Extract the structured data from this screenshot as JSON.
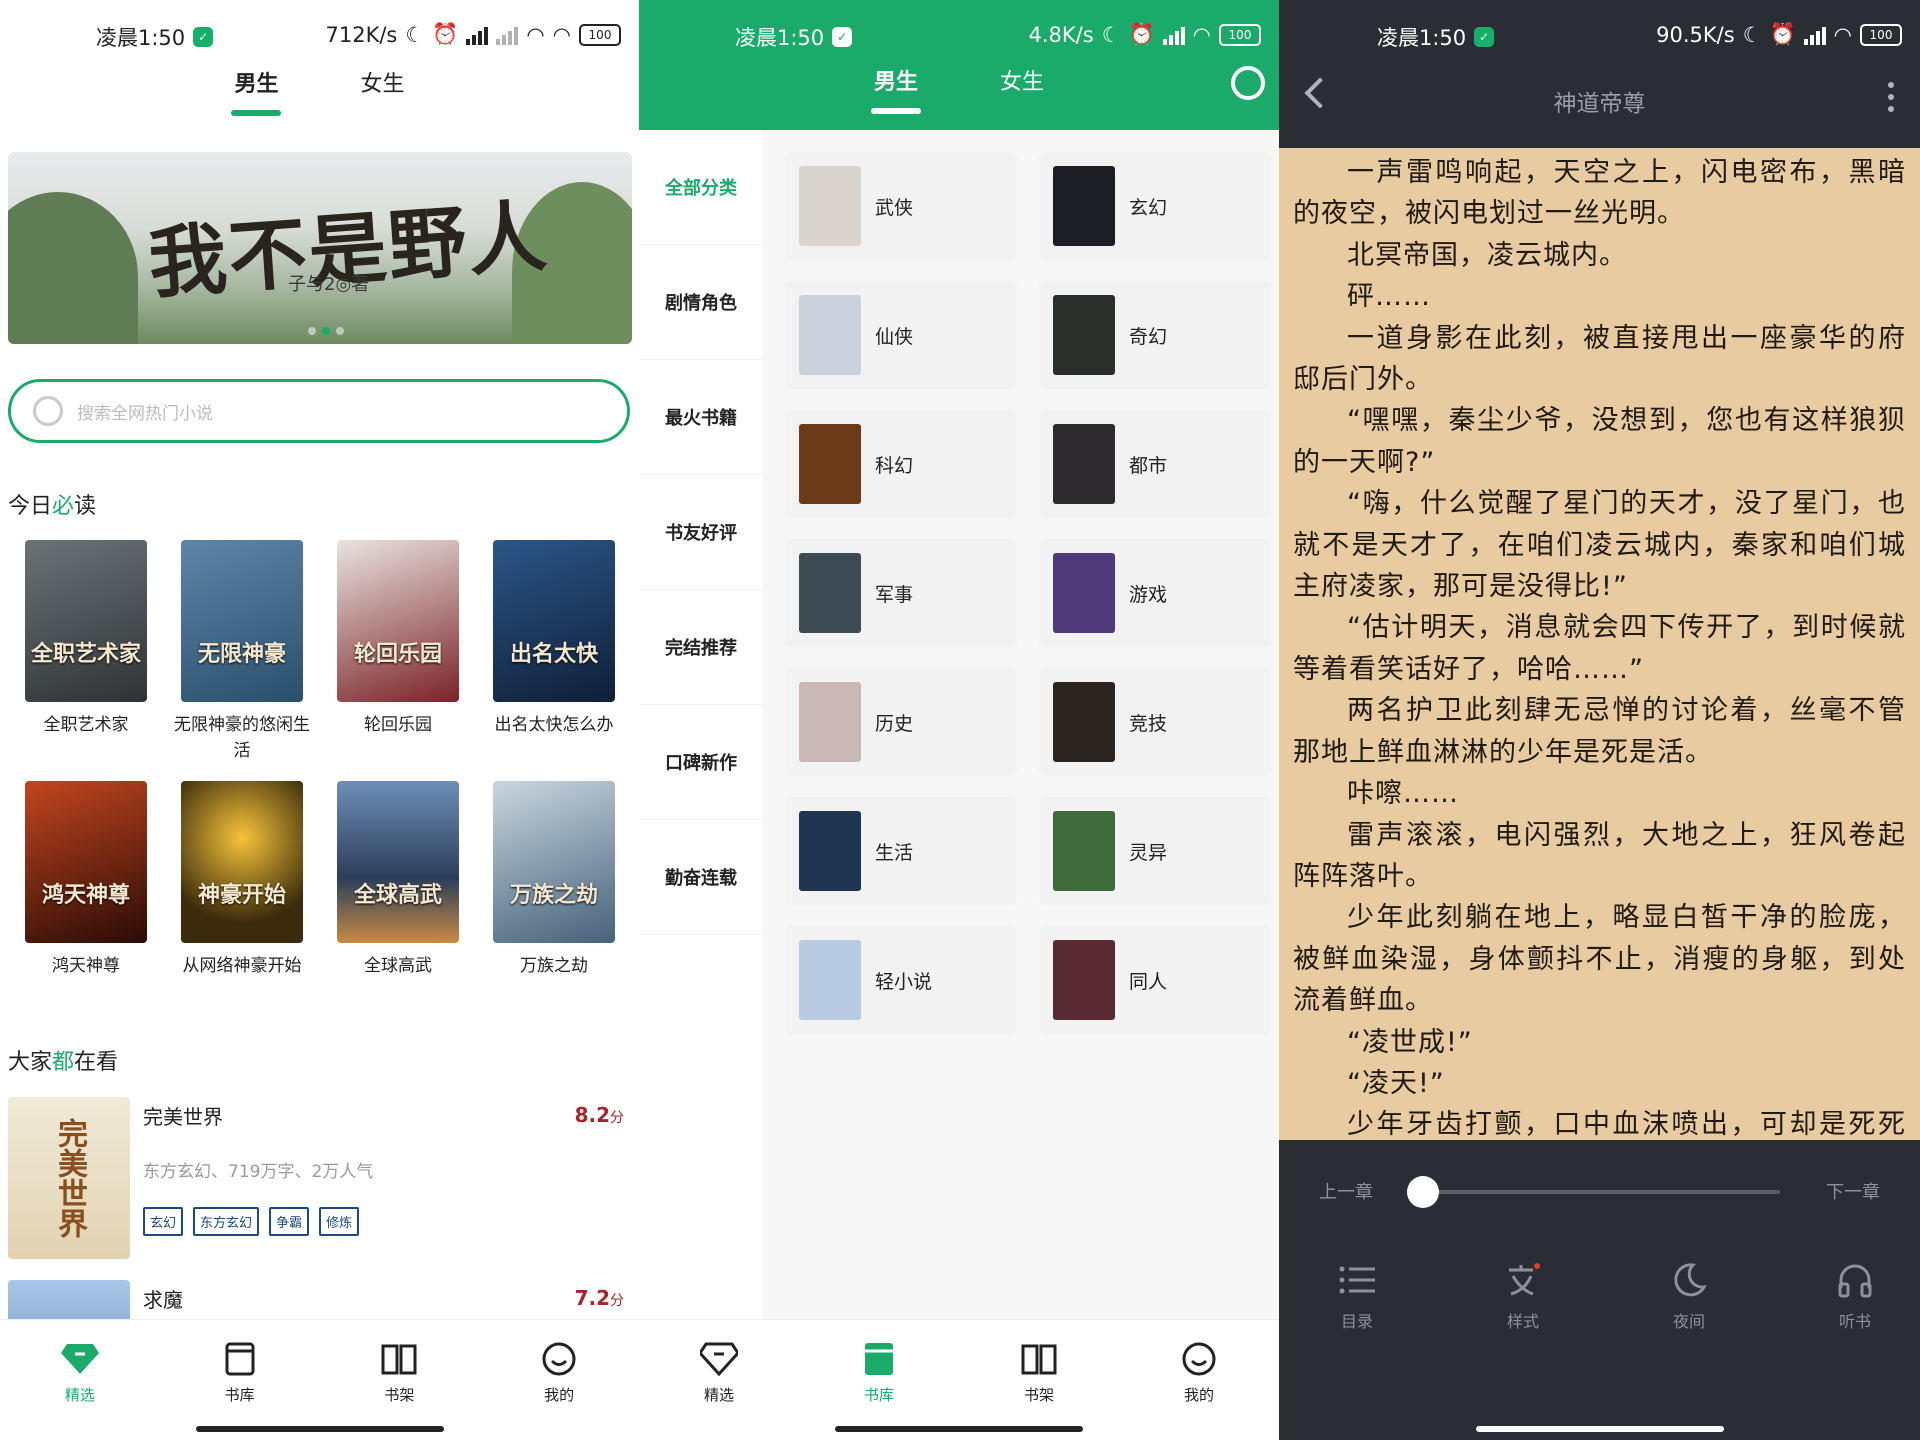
{
  "status": {
    "p1": {
      "time": "凌晨1:50",
      "speed": "712K/s",
      "battery": "100"
    },
    "p2": {
      "time": "凌晨1:50",
      "speed": "4.8K/s",
      "battery": "100"
    },
    "p3": {
      "time": "凌晨1:50",
      "speed": "90.5K/s",
      "battery": "100"
    }
  },
  "tabs": {
    "male": "男生",
    "female": "女生"
  },
  "banner": {
    "title": "我不是野人",
    "subtitle": "子与2◎著"
  },
  "search": {
    "placeholder": "搜索全网热门小说"
  },
  "today": {
    "prefix": "今日",
    "highlight": "必",
    "suffix": "读"
  },
  "books": [
    {
      "name": "全职艺术家",
      "cover_text": "全职艺术家",
      "color": "#2f3336"
    },
    {
      "name": "无限神豪的悠闲生活",
      "cover_text": "无限神豪",
      "color": "#2a4f6b"
    },
    {
      "name": "轮回乐园",
      "cover_text": "轮回乐园",
      "color": "#7b2229"
    },
    {
      "name": "出名太快怎么办",
      "cover_text": "出名太快",
      "color": "#1f3e68"
    },
    {
      "name": "鸿天神尊",
      "cover_text": "鸿天神尊",
      "color": "#5a1d12"
    },
    {
      "name": "从网络神豪开始",
      "cover_text": "神豪开始",
      "color": "#3b2b0c"
    },
    {
      "name": "全球高武",
      "cover_text": "全球高武",
      "color": "#2b3e59"
    },
    {
      "name": "万族之劫",
      "cover_text": "万族之劫",
      "color": "#46627a"
    }
  ],
  "everyone": {
    "prefix": "大家",
    "highlight": "都",
    "suffix": "在看"
  },
  "popular": [
    {
      "title": "完美世界",
      "score": "8.2",
      "unit": "分",
      "meta": "东方玄幻、719万字、2万人气",
      "tags": [
        "玄幻",
        "东方玄幻",
        "争霸",
        "修炼"
      ],
      "cover_text": "完美世界"
    },
    {
      "title": "求魔",
      "score": "7.2",
      "unit": "分"
    }
  ],
  "nav": [
    {
      "label": "精选",
      "icon": "diamond-icon"
    },
    {
      "label": "书库",
      "icon": "book-icon"
    },
    {
      "label": "书架",
      "icon": "open-book-icon"
    },
    {
      "label": "我的",
      "icon": "smile-icon"
    }
  ],
  "categories_sidebar": [
    "全部分类",
    "剧情角色",
    "最火书籍",
    "书友好评",
    "完结推荐",
    "口碑新作",
    "勤奋连载"
  ],
  "categories": [
    {
      "label": "武侠",
      "color": "#d9d4cc"
    },
    {
      "label": "玄幻",
      "color": "#1d1d24"
    },
    {
      "label": "仙侠",
      "color": "#c9d2dc"
    },
    {
      "label": "奇幻",
      "color": "#2b2f2c"
    },
    {
      "label": "科幻",
      "color": "#6b3a18"
    },
    {
      "label": "都市",
      "color": "#2d2a2d"
    },
    {
      "label": "军事",
      "color": "#3d4b55"
    },
    {
      "label": "游戏",
      "color": "#4d3a78"
    },
    {
      "label": "历史",
      "color": "#c9b8b5"
    },
    {
      "label": "竞技",
      "color": "#2a2520"
    },
    {
      "label": "生活",
      "color": "#1f3552"
    },
    {
      "label": "灵异",
      "color": "#3f6b3c"
    },
    {
      "label": "轻小说",
      "color": "#b8c9e2"
    },
    {
      "label": "同人",
      "color": "#5a2a34"
    }
  ],
  "reader": {
    "title": "神道帝尊",
    "paragraphs": [
      "一声雷鸣响起，天空之上，闪电密布，黑暗的夜空，被闪电划过一丝光明。",
      "北冥帝国，凌云城内。",
      "砰……",
      "一道身影在此刻，被直接甩出一座豪华的府邸后门外。",
      "“嘿嘿，秦尘少爷，没想到，您也有这样狼狈的一天啊?”",
      "“嗨，什么觉醒了星门的天才，没了星门，也就不是天才了，在咱们凌云城内，秦家和咱们城主府凌家，那可是没得比!”",
      "“估计明天，消息就会四下传开了，到时候就等着看笑话好了，哈哈……”",
      "两名护卫此刻肆无忌惮的讨论着，丝毫不管那地上鲜血淋淋的少年是死是活。",
      "咔嚓……",
      "雷声滚滚，电闪强烈，大地之上，狂风卷起阵阵落叶。",
      "少年此刻躺在地上，略显白皙干净的脸庞，被鲜血染湿，身体颤抖不止，消瘦的身躯，到处流着鲜血。",
      "“凌世成!”",
      "“凌天!”",
      "少年牙齿打颤，口中血沫喷出，可却是死死咬"
    ],
    "prev_chapter": "上一章",
    "next_chapter": "下一章",
    "progress": 0.0,
    "tools": [
      {
        "label": "目录",
        "icon": "list-icon"
      },
      {
        "label": "样式",
        "icon": "text-style-icon"
      },
      {
        "label": "夜间",
        "icon": "moon-icon"
      },
      {
        "label": "听书",
        "icon": "headphones-icon"
      }
    ]
  },
  "colors": {
    "accent": "#1aab6b",
    "score": "#a8232a",
    "reader_bg": "#e8cba0",
    "dark": "#2a2d33"
  }
}
